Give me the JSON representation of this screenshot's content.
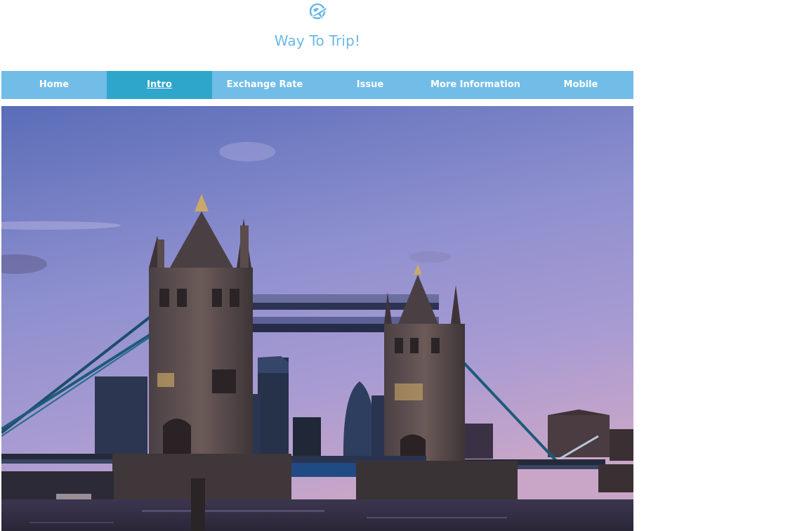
{
  "site": {
    "logo_icon": "plane-globe-icon",
    "title": "Way To Trip!"
  },
  "nav": {
    "items": [
      {
        "label": "Home",
        "active": false
      },
      {
        "label": "Intro",
        "active": true
      },
      {
        "label": "Exchange Rate",
        "active": false
      },
      {
        "label": "Issue",
        "active": false
      },
      {
        "label": "More Information",
        "active": false
      },
      {
        "label": "Mobile",
        "active": false
      }
    ]
  },
  "colors": {
    "brand": "#6cb8e4",
    "nav_bg": "#71bde8",
    "nav_active": "#2ea6cb",
    "nav_text": "#ffffff"
  },
  "hero": {
    "image": "tower-bridge-dusk-photo"
  }
}
